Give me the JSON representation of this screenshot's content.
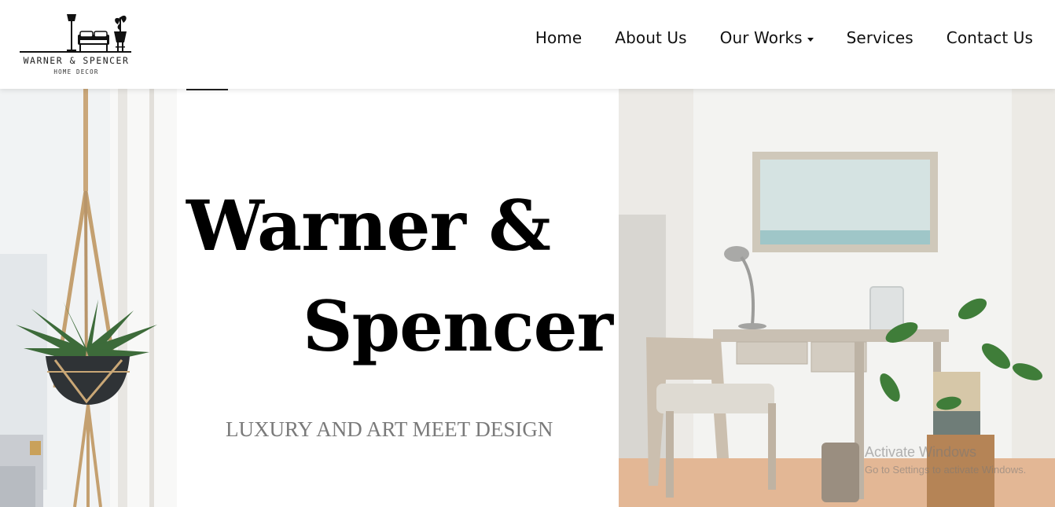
{
  "brand": {
    "name": "WARNER & SPENCER",
    "tagline": "HOME DECOR"
  },
  "nav": {
    "items": [
      {
        "label": "Home"
      },
      {
        "label": "About Us"
      },
      {
        "label": "Our Works",
        "has_dropdown": true
      },
      {
        "label": "Services"
      },
      {
        "label": "Contact Us"
      }
    ]
  },
  "hero": {
    "title_line1": "Warner &",
    "title_line2": "Spencer",
    "subtitle": "LUXURY AND ART MEET DESIGN"
  },
  "images": {
    "left": "hanging-macrame-planter-photo",
    "right": "white-room-desk-chair-plant-photo"
  },
  "watermark": {
    "title": "Activate Windows",
    "subtitle": "Go to Settings to activate Windows."
  },
  "colors": {
    "accent": "#000000",
    "subtitle": "#7a7a7a",
    "background": "#ffffff"
  }
}
